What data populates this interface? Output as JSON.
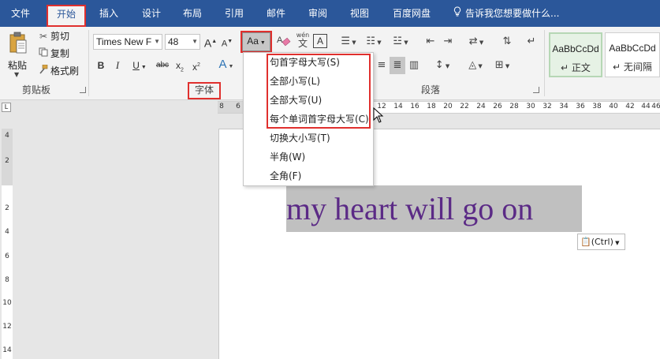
{
  "menubar": {
    "tabs": [
      "文件",
      "开始",
      "插入",
      "设计",
      "布局",
      "引用",
      "邮件",
      "审阅",
      "视图",
      "百度网盘"
    ],
    "active_tab": "开始",
    "tell_me": "告诉我您想要做什么...",
    "bg_color": "#2b579a"
  },
  "clipboard": {
    "paste": "粘贴",
    "cut": "剪切",
    "copy": "复制",
    "format_painter": "格式刷",
    "group_label": "剪贴板"
  },
  "font": {
    "name": "Times New F",
    "size": "48",
    "change_case": "Aa",
    "phonetic_top": "wén",
    "phonetic_bottom": "文",
    "char_border": "A",
    "bold": "B",
    "italic": "I",
    "underline": "U",
    "strikethrough": "abc",
    "subscript": "x",
    "subscript_mark": "2",
    "superscript": "x",
    "superscript_mark": "2",
    "grow": "A",
    "shrink": "A",
    "text_effects": "A",
    "group_label": "字体"
  },
  "paragraph": {
    "group_label": "段落"
  },
  "styles": [
    {
      "sample": "AaBbCcDd",
      "name": "正文"
    },
    {
      "sample": "AaBbCcDd",
      "name": "无间隔"
    }
  ],
  "case_menu": {
    "items": [
      {
        "label": "句首字母大写(S)"
      },
      {
        "label": "全部小写(L)"
      },
      {
        "label": "全部大写(U)"
      },
      {
        "label": "每个单词首字母大写(C)"
      },
      {
        "label": "切换大小写(T)"
      },
      {
        "label": "半角(W)"
      },
      {
        "label": "全角(F)"
      }
    ]
  },
  "ruler": {
    "ticks": [
      "8",
      "6",
      "12",
      "14",
      "16",
      "18",
      "20",
      "22",
      "24",
      "26",
      "28",
      "30",
      "32",
      "34",
      "36",
      "38",
      "40",
      "42",
      "44",
      "46"
    ],
    "corner": "L"
  },
  "vruler": {
    "ticks": [
      "4",
      "2",
      "2",
      "4",
      "6",
      "8",
      "10",
      "12",
      "14"
    ]
  },
  "document": {
    "text": "my heart will go on",
    "text_color": "#5b2a86",
    "selection_color": "#c0c0c0",
    "paste_options": "(Ctrl)"
  }
}
